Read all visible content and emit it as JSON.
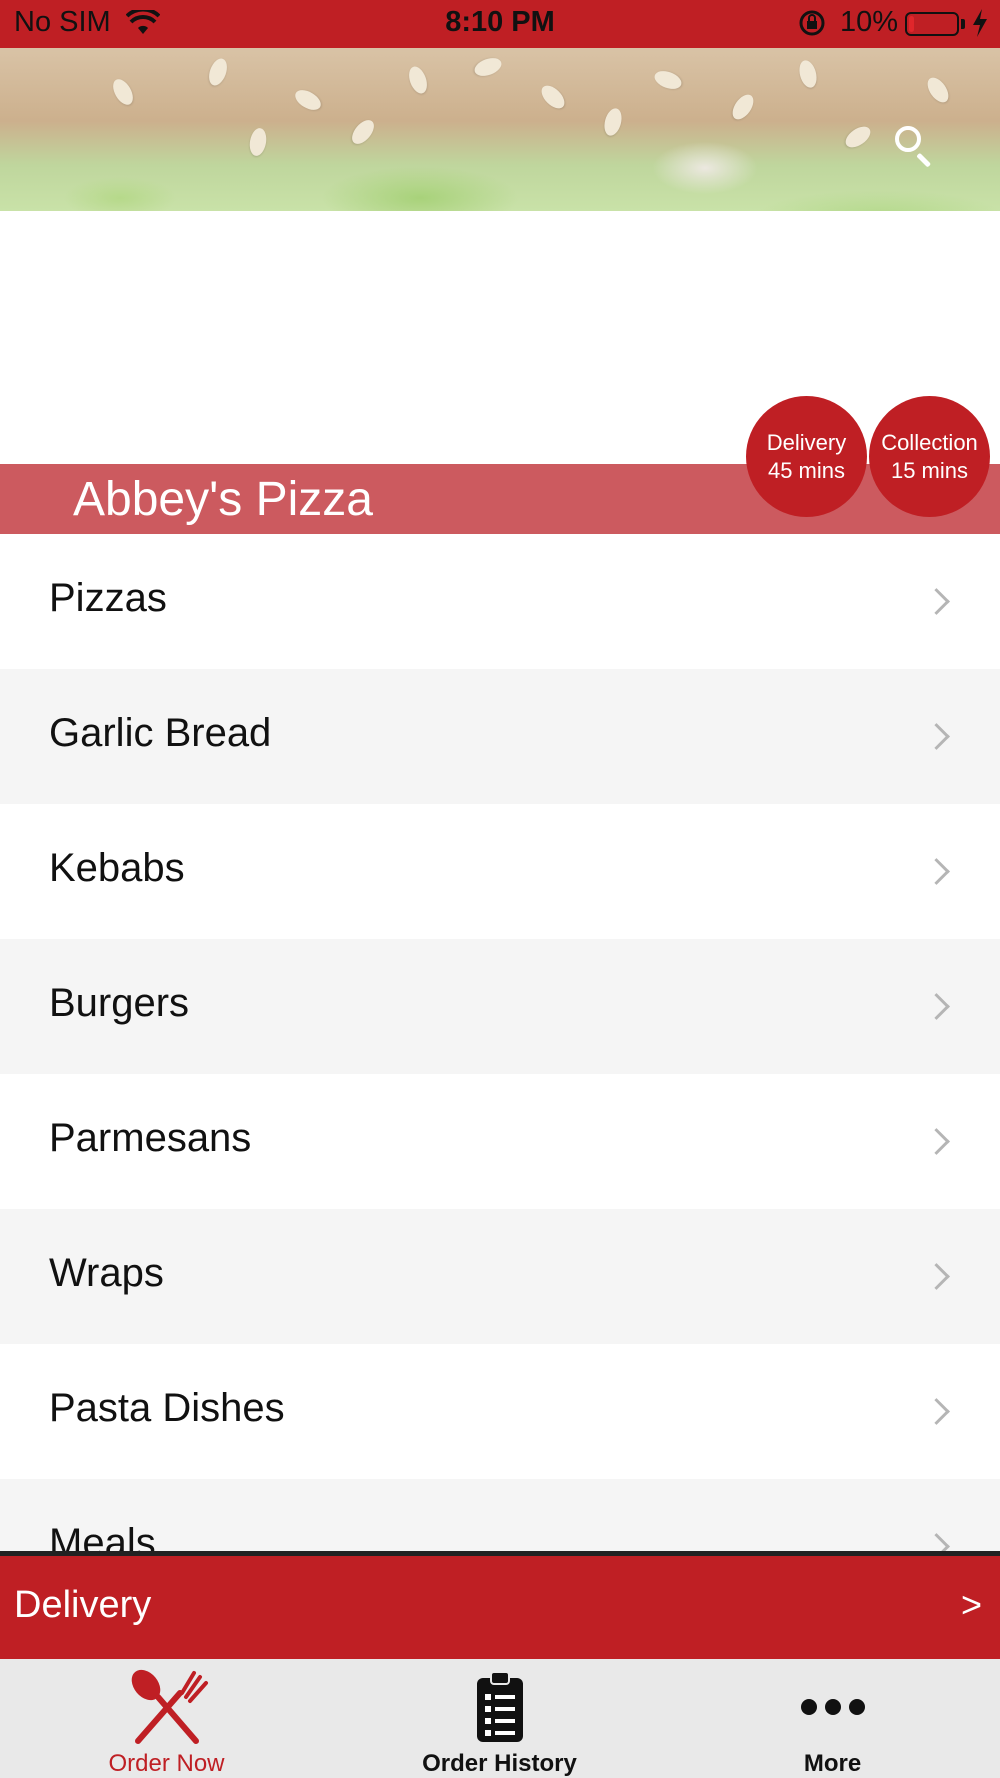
{
  "status_bar": {
    "carrier": "No SIM",
    "time": "8:10 PM",
    "battery_pct": "10%",
    "battery_level": 0.1,
    "icons": [
      "wifi-icon",
      "orientation-lock-icon",
      "battery-icon",
      "charging-bolt-icon"
    ]
  },
  "header": {
    "search_icon": "search-icon"
  },
  "restaurant": {
    "name": "Abbey's Pizza",
    "delivery": {
      "label": "Delivery",
      "time": "45 mins"
    },
    "collection": {
      "label": "Collection",
      "time": "15 mins"
    }
  },
  "menu": {
    "categories": [
      "Pizzas",
      "Garlic Bread",
      "Kebabs",
      "Burgers",
      "Parmesans",
      "Wraps",
      "Pasta Dishes",
      "Meals"
    ]
  },
  "order_mode": {
    "label": "Delivery",
    "arrow": ">"
  },
  "tabs": [
    {
      "label": "Order Now",
      "icon": "fork-knife-icon",
      "active": true
    },
    {
      "label": "Order History",
      "icon": "clipboard-list-icon",
      "active": false
    },
    {
      "label": "More",
      "icon": "more-dots-icon",
      "active": false
    }
  ],
  "colors": {
    "brand_red": "#bf1f24",
    "title_bar": "#cc5a5f",
    "tab_bar": "#e9e9e9",
    "row_alt": "#f5f5f5"
  }
}
